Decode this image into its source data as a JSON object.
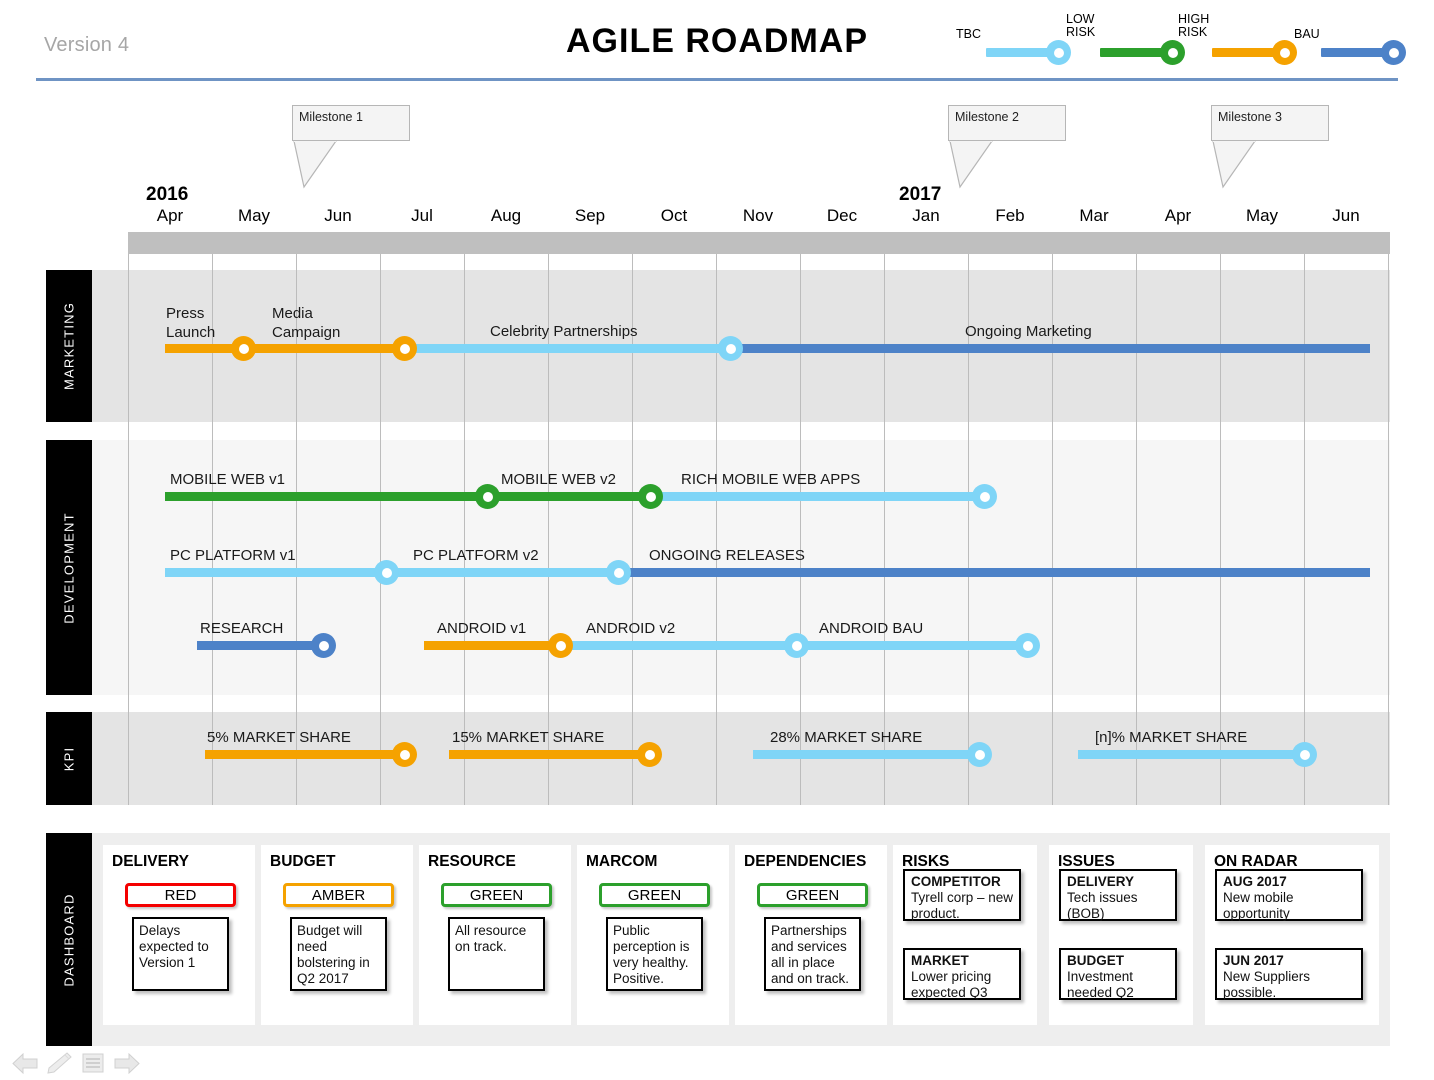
{
  "header": {
    "version": "Version 4",
    "title": "AGILE ROADMAP",
    "legend": [
      {
        "label": "TBC",
        "color": "#7fd5f7"
      },
      {
        "label": "LOW\nRISK",
        "color": "#2ca02c"
      },
      {
        "label": "HIGH\nRISK",
        "color": "#f5a200"
      },
      {
        "label": "BAU",
        "color": "#4d82c8"
      }
    ]
  },
  "milestones": [
    {
      "label": "Milestone 1"
    },
    {
      "label": "Milestone 2"
    },
    {
      "label": "Milestone 3"
    }
  ],
  "timeline": {
    "years": [
      {
        "label": "2016"
      },
      {
        "label": "2017"
      }
    ],
    "months": [
      "Apr",
      "May",
      "Jun",
      "Jul",
      "Aug",
      "Sep",
      "Oct",
      "Nov",
      "Dec",
      "Jan",
      "Feb",
      "Mar",
      "Apr",
      "May",
      "Jun"
    ]
  },
  "lanes": [
    {
      "name": "MARKETING"
    },
    {
      "name": "DEVELOPMENT"
    },
    {
      "name": "KPI"
    }
  ],
  "tracks": {
    "marketing": [
      {
        "label": "Press\nLaunch"
      },
      {
        "label": "Media\nCampaign"
      },
      {
        "label": "Celebrity Partnerships"
      },
      {
        "label": "Ongoing Marketing"
      }
    ],
    "development_row1": [
      {
        "label": "MOBILE WEB v1"
      },
      {
        "label": "MOBILE WEB v2"
      },
      {
        "label": "RICH  MOBILE WEB APPS"
      }
    ],
    "development_row2": [
      {
        "label": "PC PLATFORM v1"
      },
      {
        "label": "PC PLATFORM v2"
      },
      {
        "label": "ONGOING  RELEASES"
      }
    ],
    "development_row3": [
      {
        "label": "RESEARCH"
      },
      {
        "label": "ANDROID v1"
      },
      {
        "label": "ANDROID v2"
      },
      {
        "label": "ANDROID BAU"
      }
    ],
    "kpi": [
      {
        "label": "5% MARKET SHARE"
      },
      {
        "label": "15% MARKET SHARE"
      },
      {
        "label": "28% MARKET SHARE"
      },
      {
        "label": "[n]% MARKET SHARE"
      }
    ]
  },
  "dashboard": {
    "lane_name": "DASHBOARD",
    "rag_cards": [
      {
        "title": "DELIVERY",
        "status": "RED",
        "status_color": "#f40000",
        "note": "Delays expected to Version 1"
      },
      {
        "title": "BUDGET",
        "status": "AMBER",
        "status_color": "#f5a200",
        "note": "Budget will need bolstering in Q2 2017"
      },
      {
        "title": "RESOURCE",
        "status": "GREEN",
        "status_color": "#2ca02c",
        "note": "All resource on track."
      },
      {
        "title": "MARCOM",
        "status": "GREEN",
        "status_color": "#2ca02c",
        "note": "Public perception is very healthy. Positive."
      },
      {
        "title": "DEPENDENCIES",
        "status": "GREEN",
        "status_color": "#2ca02c",
        "note": "Partnerships and services all in place and on track."
      }
    ],
    "list_cards": [
      {
        "title": "RISKS",
        "items": [
          {
            "heading": "COMPETITOR",
            "body": "Tyrell corp – new product."
          },
          {
            "heading": "MARKET",
            "body": "Lower pricing expected Q3"
          }
        ]
      },
      {
        "title": "ISSUES",
        "items": [
          {
            "heading": "DELIVERY",
            "body": "Tech issues (BOB)"
          },
          {
            "heading": "BUDGET",
            "body": "Investment needed Q2"
          }
        ]
      },
      {
        "title": "ON RADAR",
        "items": [
          {
            "heading": "AUG 2017",
            "body": "New mobile opportunity"
          },
          {
            "heading": "JUN 2017",
            "body": "New Suppliers possible."
          }
        ]
      }
    ]
  },
  "footer": {
    "icons": [
      "back-arrow-icon",
      "pencil-icon",
      "list-icon",
      "forward-arrow-icon"
    ]
  },
  "colors": {
    "tbc": "#7fd5f7",
    "low_risk": "#2ca02c",
    "high_risk": "#f5a200",
    "bau": "#4d82c8",
    "accent_rule": "#6f94c4"
  }
}
